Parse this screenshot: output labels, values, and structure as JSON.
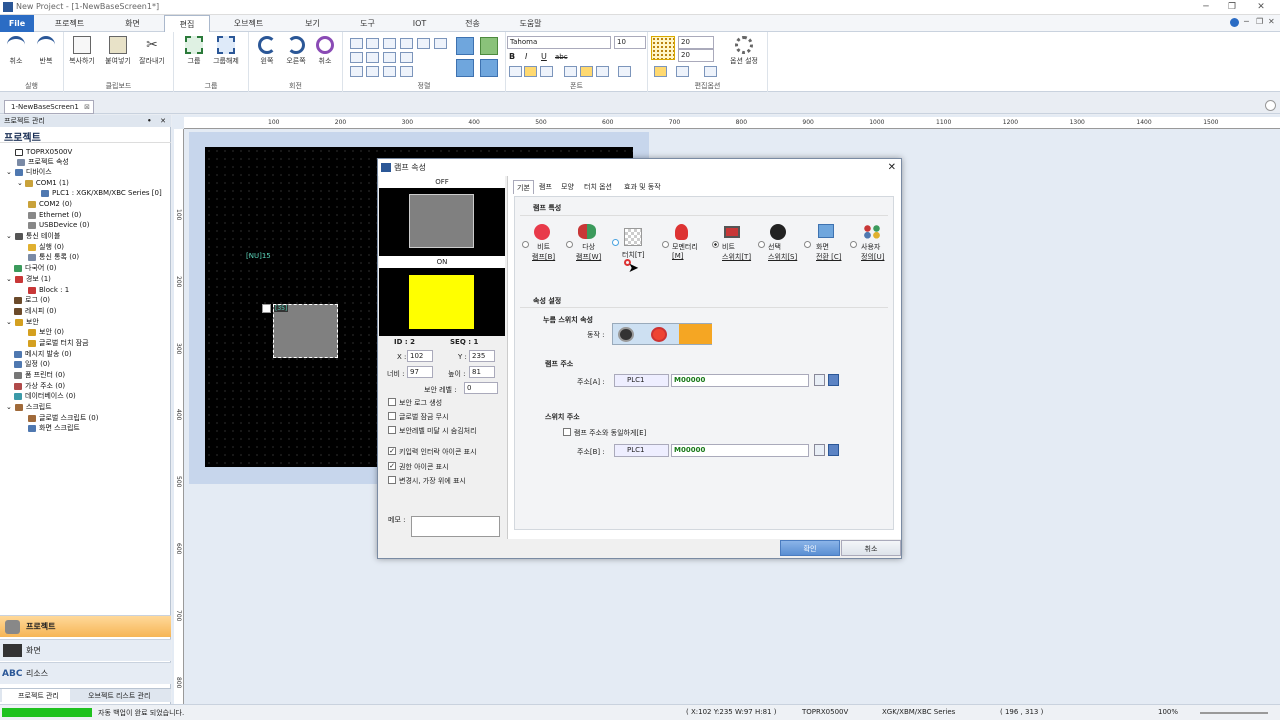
{
  "window": {
    "title": "New Project - [1-NewBaseScreen1*]"
  },
  "menu": [
    "File",
    "프로젝트",
    "화면",
    "편집",
    "오브젝트",
    "보기",
    "도구",
    "IOT",
    "전송",
    "도움말"
  ],
  "ribbon": {
    "groups": [
      "실행",
      "클립보드",
      "그룹",
      "회전",
      "정렬",
      "폰트",
      "편집옵션"
    ],
    "buttons": {
      "undo": "취소",
      "redo": "반복",
      "copy": "복사하기",
      "paste": "붙여넣기",
      "cut": "잘라내기",
      "group": "그룹",
      "ungroup": "그룹해제",
      "rot_left": "왼쪽",
      "rot_right": "오른쪽",
      "rot_cancel": "취소",
      "options": "옵션 설정"
    },
    "font_name": "Tahoma",
    "font_size": "10",
    "grid_x": "20",
    "grid_y": "20"
  },
  "doc_tab": "1-NewBaseScreen1",
  "left_panel": {
    "header": "프로젝트 관리",
    "title": "프로젝트",
    "tree": [
      "TOPRX0500V",
      "프로젝트 속성",
      "디바이스",
      "COM1 (1)",
      "PLC1 : XGK/XBM/XBC Series [0]",
      "COM2 (0)",
      "Ethernet (0)",
      "USBDevice (0)",
      "통신 테이블",
      "실행 (0)",
      "통신 통록 (0)",
      "다국어 (0)",
      "경보 (1)",
      "Block : 1",
      "로그 (0)",
      "레시피 (0)",
      "보안",
      "보안 (0)",
      "글로벌 터치 잠금",
      "메시지 발송 (0)",
      "일정 (0)",
      "폼 프린터 (0)",
      "가상 주소 (0)",
      "데이터베이스 (0)",
      "스크립트",
      "글로벌 스크립트 (0)",
      "화면 스크립트"
    ],
    "bottom_tabs": [
      "프로젝트",
      "화면",
      "리소스"
    ],
    "footer_tabs": [
      "프로젝트 관리",
      "오브젝트 리스트 관리"
    ]
  },
  "ruler": {
    "h": [
      "100",
      "200",
      "300",
      "400",
      "500",
      "600",
      "700",
      "800",
      "900",
      "1000",
      "1100",
      "1200",
      "1300",
      "1400",
      "1500"
    ],
    "v": [
      "100",
      "200",
      "300",
      "400",
      "500",
      "600",
      "700",
      "800"
    ]
  },
  "canvas": {
    "nu_label": "[NU]15",
    "lamp_label": "[35]"
  },
  "dialog": {
    "title": "램프 속성",
    "off_label": "OFF",
    "on_label": "ON",
    "id": "ID : 2",
    "seq": "SEQ : 1",
    "x_label": "X :",
    "x_value": "102",
    "y_label": "Y :",
    "y_value": "235",
    "w_label": "너비 :",
    "w_value": "97",
    "h_label": "높이 :",
    "h_value": "81",
    "security_label": "보안 레벨 :",
    "security_value": "0",
    "checks": [
      {
        "label": "보안 로그 생성",
        "checked": false
      },
      {
        "label": "글로벌 잠금 무시",
        "checked": false
      },
      {
        "label": "보안레벨 미달 시 숨김처리",
        "checked": false
      },
      {
        "label": "키입력 인터락 아이콘 표시",
        "checked": true
      },
      {
        "label": "권한 아이콘 표시",
        "checked": true
      },
      {
        "label": "변경시, 가장 위에 표시",
        "checked": false
      }
    ],
    "memo_label": "메모 :",
    "tabs": [
      "기본",
      "램프",
      "모양",
      "터치 옵션",
      "효과 및 동작"
    ],
    "lamp_type_title": "램프 특성",
    "lamp_types": [
      {
        "l1": "비트",
        "l2": "램프[B]"
      },
      {
        "l1": "다상",
        "l2": "램프[W]"
      },
      {
        "l1": "",
        "l2": "터치[T]"
      },
      {
        "l1": "모멘터리",
        "l2": "[M]"
      },
      {
        "l1": "비트",
        "l2": "스위치[T]"
      },
      {
        "l1": "선택",
        "l2": "스위치[S]"
      },
      {
        "l1": "화면",
        "l2": "전환 [C]"
      },
      {
        "l1": "사용자",
        "l2": "정의[U]"
      }
    ],
    "attr_title": "속성 설정",
    "press_title": "누름 스위치 속성",
    "action_label": "동작 :",
    "lamp_addr_title": "램프 주소",
    "addr_label": "주소[A] :",
    "plc": "PLC1",
    "lamp_addr": "M00000",
    "switch_addr_title": "스위치 주소",
    "same_as_lamp": "램프 주소와 동일하게[E]",
    "addr2_label": "주소[B] :",
    "plc2": "PLC1",
    "switch_addr": "M00000",
    "ok": "확인",
    "cancel": "취소"
  },
  "status": {
    "msg": "자동 백업이 완료 되었습니다.",
    "coords": "( X:102 Y:235 W:97 H:81 )",
    "model": "TOPRX0500V",
    "series": "XGK/XBM/XBC Series",
    "cursor": "( 196 , 313 )",
    "zoom": "100%"
  }
}
